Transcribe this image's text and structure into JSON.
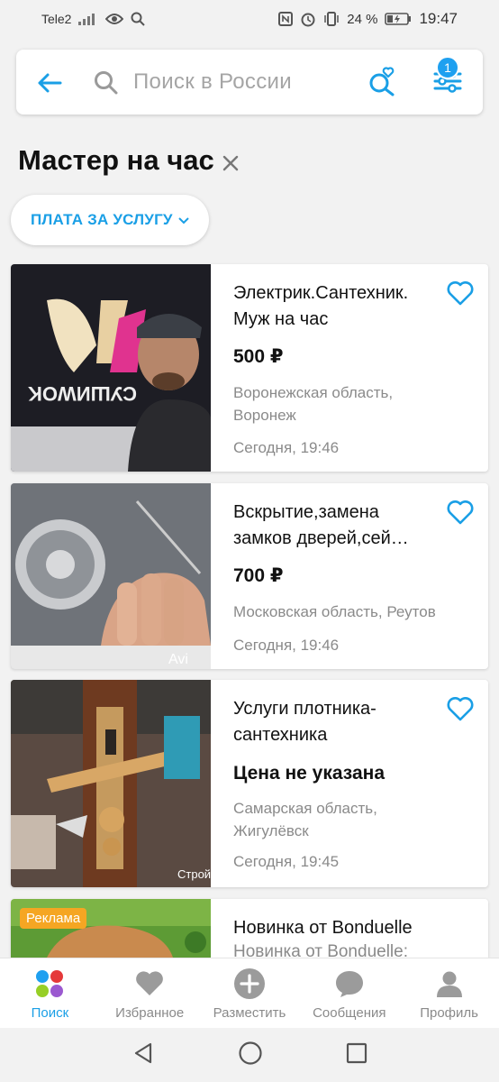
{
  "status_bar": {
    "carrier": "Tele2",
    "battery": "24 %",
    "time": "19:47"
  },
  "search": {
    "placeholder": "Поиск в России",
    "filter_badge": "1"
  },
  "page": {
    "title": "Мастер на час",
    "chip_label": "ПЛАТА ЗА УСЛУГУ"
  },
  "listings": [
    {
      "title": "Электрик.Сантехник. Муж на час",
      "price": "500 ₽",
      "location": "Воронежская область, Воронеж",
      "date": "Сегодня, 19:46",
      "thumb_text": "СУШИWOK"
    },
    {
      "title": "Вскрытие,замена замков дверей,сей…",
      "price": "700 ₽",
      "location": "Московская область, Реутов",
      "date": "Сегодня, 19:46",
      "thumb_text": "Avi"
    },
    {
      "title": "Услуги плотника-сантехника",
      "price": "Цена не указана",
      "location": "Самарская область, Жигулёвск",
      "date": "Сегодня, 19:45",
      "thumb_text": "Строй"
    },
    {
      "title": "Новинка от Bonduelle",
      "subtitle": "Новинка от Bonduelle:",
      "ad_badge": "Реклама"
    }
  ],
  "tabbar": [
    {
      "label": "Поиск",
      "icon": "search-dots-icon",
      "active": true
    },
    {
      "label": "Избранное",
      "icon": "heart-icon",
      "active": false
    },
    {
      "label": "Разместить",
      "icon": "plus-icon",
      "active": false
    },
    {
      "label": "Сообщения",
      "icon": "chat-icon",
      "active": false
    },
    {
      "label": "Профиль",
      "icon": "person-icon",
      "active": false
    }
  ],
  "colors": {
    "accent": "#1a9fe6",
    "ad": "#f5a623"
  }
}
